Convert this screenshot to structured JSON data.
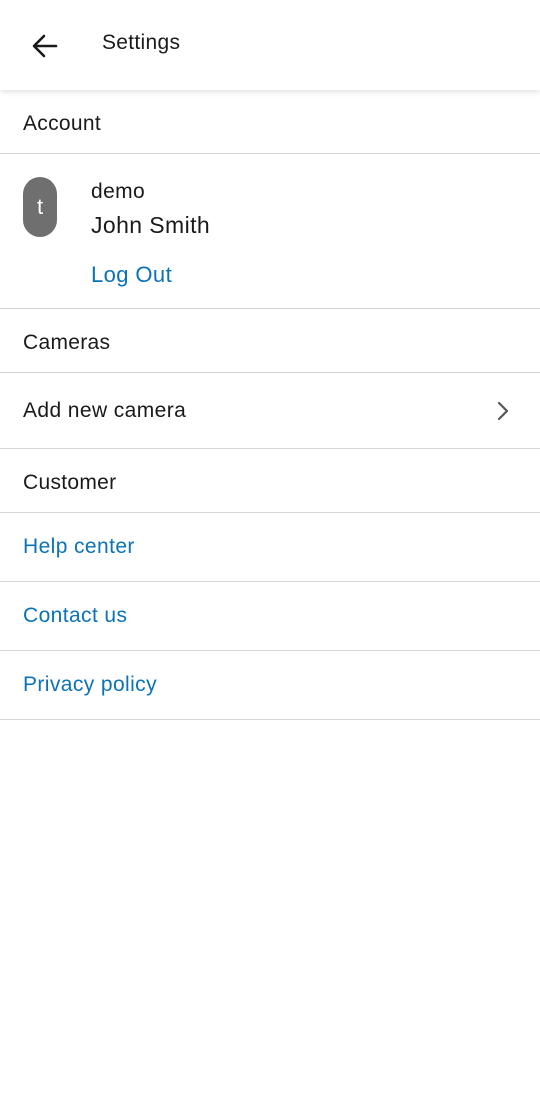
{
  "header": {
    "title": "Settings",
    "back_icon": "arrow-left-icon"
  },
  "account": {
    "section_label": "Account",
    "avatar_letter": "t",
    "username": "demo",
    "full_name": "John Smith",
    "logout_label": "Log Out"
  },
  "cameras": {
    "section_label": "Cameras",
    "add_label": "Add new camera",
    "chevron_icon": "chevron-right-icon"
  },
  "customer": {
    "section_label": "Customer",
    "links": [
      {
        "label": "Help center"
      },
      {
        "label": "Contact us"
      },
      {
        "label": "Privacy policy"
      }
    ]
  },
  "colors": {
    "link": "#0b73b6",
    "avatar_bg": "#6f6f6f",
    "divider": "#d6d6d6"
  }
}
